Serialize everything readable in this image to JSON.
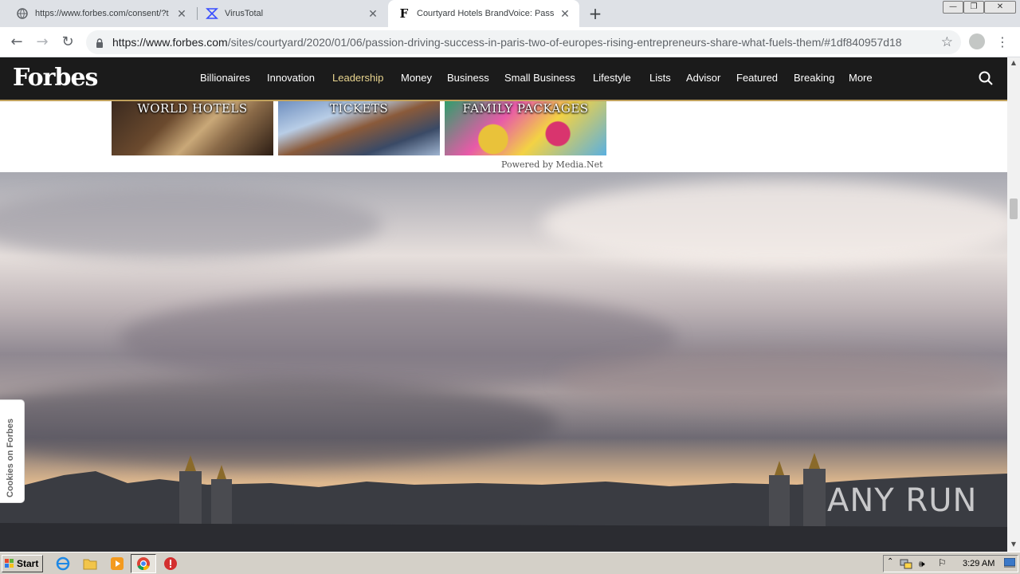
{
  "browser": {
    "tabs": [
      {
        "title": "https://www.forbes.com/consent/?t",
        "icon": "globe-icon"
      },
      {
        "title": "VirusTotal",
        "icon": "virustotal-icon"
      },
      {
        "title": "Courtyard Hotels BrandVoice: Passio",
        "icon": "forbes-f-icon"
      }
    ],
    "url_host": "https://www.forbes.com",
    "url_path": "/sites/courtyard/2020/01/06/passion-driving-success-in-paris-two-of-europes-rising-entrepreneurs-share-what-fuels-them/#1df840957d18"
  },
  "forbes": {
    "logo": "Forbes",
    "nav": [
      "Billionaires",
      "Innovation",
      "Leadership",
      "Money",
      "Business",
      "Small Business",
      "Lifestyle",
      "Lists",
      "Advisor",
      "Featured",
      "Breaking",
      "More"
    ],
    "active_nav": "Leadership"
  },
  "ads": {
    "tiles": [
      "WORLD HOTELS",
      "TICKETS",
      "FAMILY PACKAGES"
    ],
    "powered_by": "Powered by Media.Net"
  },
  "cookies_tab": "Cookies on Forbes",
  "watermark": "ANY RUN",
  "taskbar": {
    "start": "Start",
    "clock": "3:29 AM"
  },
  "colors": {
    "forbes_bar": "#1b1b1b",
    "accent_gold": "#c0a15c",
    "active_nav": "#e9d58f"
  }
}
